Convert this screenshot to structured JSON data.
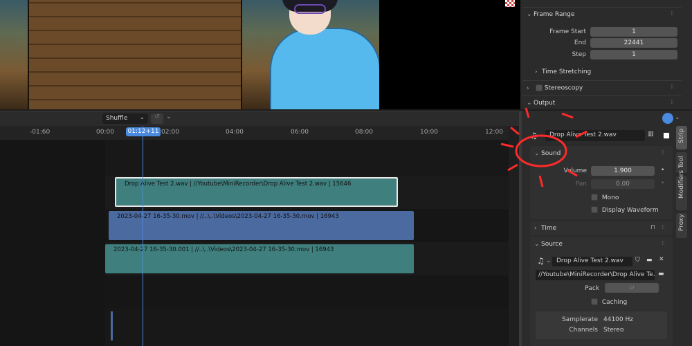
{
  "properties": {
    "frame_range": {
      "header": "Frame Range",
      "start_label": "Frame Start",
      "start_value": "1",
      "end_label": "End",
      "end_value": "22441",
      "step_label": "Step",
      "step_value": "1"
    },
    "time_stretching": "Time Stretching",
    "stereoscopy": "Stereoscopy",
    "output": "Output"
  },
  "timeline": {
    "playback_mode": "Shuffle",
    "playhead": "01:12+11",
    "ticks": [
      "-01:60",
      "00:00",
      "02:00",
      "04:00",
      "06:00",
      "08:00",
      "10:00",
      "12:00"
    ],
    "strips": [
      {
        "label": "Drop Alive Test 2.wav | //Youtube\\MiniRecorder\\Drop Alive Test 2.wav | 15646",
        "kind": "sound"
      },
      {
        "label": "2023-04-27 16-35-30.mov | //..\\..\\Videos\\2023-04-27 16-35-30.mov | 16943",
        "kind": "movie"
      },
      {
        "label": "2023-04-27 16-35-30.001 | //..\\..\\Videos\\2023-04-27 16-35-30.mov | 16943",
        "kind": "sound"
      }
    ]
  },
  "sidebar": {
    "strip_name": "Drop Alive Test 2.wav",
    "sound": {
      "header": "Sound",
      "volume_label": "Volume",
      "volume_value": "1.900",
      "pan_label": "Pan",
      "pan_value": "0.00",
      "mono": "Mono",
      "display_waveform": "Display Waveform"
    },
    "time": "Time",
    "source": {
      "header": "Source",
      "sound_name": "Drop Alive Test 2.wav",
      "path": "//Youtube\\MiniRecorder\\Drop Alive Te...",
      "pack_label": "Pack",
      "caching": "Caching",
      "samplerate_label": "Samplerate",
      "samplerate_value": "44100 Hz",
      "channels_label": "Channels",
      "channels_value": "Stereo"
    },
    "tabs": [
      "Strip",
      "Tool",
      "Modifiers",
      "Proxy"
    ]
  },
  "colors": {
    "accent": "#4a8adf",
    "sound_strip": "#3f7f7e",
    "movie_strip": "#4a6aa0",
    "annotation": "#ff2a2a"
  }
}
